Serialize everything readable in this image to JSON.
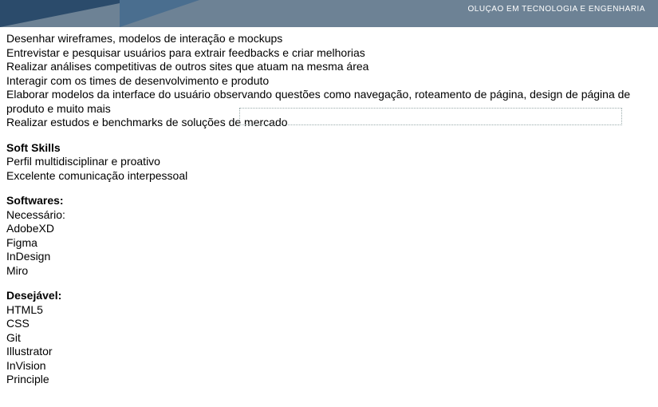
{
  "header": {
    "tagline": "OLUÇAO EM TECNOLOGIA E ENGENHARIA"
  },
  "responsibilities": {
    "items": [
      "Desenhar wireframes, modelos de interação e mockups",
      "Entrevistar e pesquisar usuários para extrair feedbacks e criar melhorias",
      "Realizar análises competitivas de outros sites que atuam na mesma área",
      "Interagir com os times de desenvolvimento  e produto",
      "Elaborar modelos da interface do usuário observando questões como navegação, roteamento de página, design de página de produto e muito mais",
      "Realizar estudos e benchmarks de soluções de mercado"
    ]
  },
  "soft_skills": {
    "heading": "Soft Skills",
    "items": [
      "Perfil multidisciplinar  e proativo",
      "Excelente comunicação interpessoal"
    ]
  },
  "softwares": {
    "heading": "Softwares:",
    "required_label": "Necessário:",
    "required_items": [
      "AdobeXD",
      "Figma",
      "InDesign",
      "Miro"
    ],
    "desired_label": "Desejável:",
    "desired_items": [
      "HTML5",
      "CSS",
      "Git",
      "Illustrator",
      "InVision",
      "Principle"
    ]
  }
}
